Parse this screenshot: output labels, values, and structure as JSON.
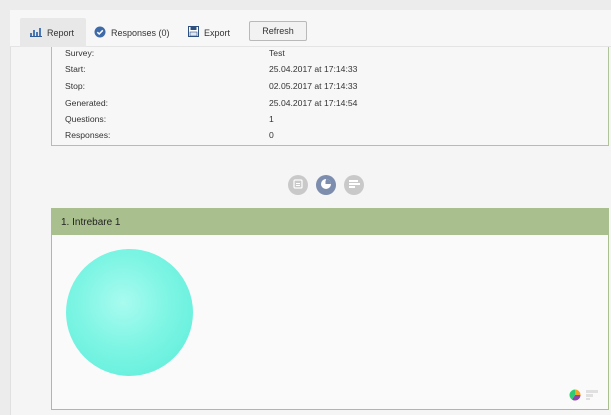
{
  "toolbar": {
    "tabs": [
      {
        "label": "Report",
        "icon": "bar-chart-icon",
        "active": true
      },
      {
        "label": "Responses (0)",
        "icon": "check-circle-icon",
        "active": false
      },
      {
        "label": "Export",
        "icon": "save-icon",
        "active": false
      }
    ],
    "refresh_label": "Refresh"
  },
  "info": {
    "rows": [
      {
        "label": "Survey:",
        "value": "Test"
      },
      {
        "label": "Start:",
        "value": "25.04.2017 at 17:14:33"
      },
      {
        "label": "Stop:",
        "value": "02.05.2017 at 17:14:33"
      },
      {
        "label": "Generated:",
        "value": "25.04.2017 at 17:14:54"
      },
      {
        "label": "Questions:",
        "value": "1"
      },
      {
        "label": "Responses:",
        "value": "0"
      }
    ]
  },
  "view_buttons": [
    {
      "icon": "list-view-icon",
      "active": false
    },
    {
      "icon": "pie-view-icon",
      "active": true
    },
    {
      "icon": "bar-view-icon",
      "active": false
    }
  ],
  "question": {
    "title": "1.  Intrebare 1"
  },
  "colors": {
    "accent_green": "#a9c08e",
    "pie_cyan": "#7ef5e4",
    "active_view": "#7c8dad"
  }
}
